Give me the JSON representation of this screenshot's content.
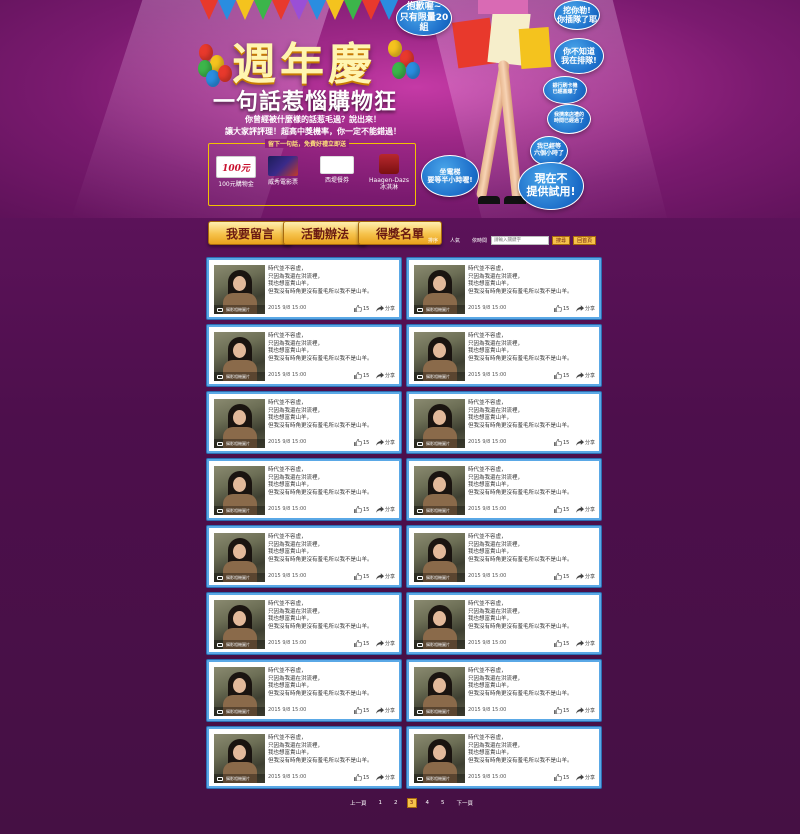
{
  "hero": {
    "title": "週年慶",
    "subtitle": "一句話惹惱購物狂",
    "desc_line1": "你曾經被什麼樣的話惹毛過？說出來！",
    "desc_line2": "讓大家評評理！超高中獎機率，你一定不能錯過！",
    "prize_box_title": "留下一句話，免費好禮立即送",
    "prizes": [
      {
        "name": "100元購物金",
        "badge": "100元"
      },
      {
        "name": "威秀電影票",
        "badge": ""
      },
      {
        "name": "西堤餐券",
        "badge": ""
      },
      {
        "name": "Haagen-Dazs\n冰淇淋",
        "badge": ""
      }
    ],
    "bubbles": [
      "抱歉喔~\n只有限量20組",
      "挖你勒!\n你插隊了耶",
      "你不知道\n我在排隊!",
      "銀行刷卡機\n已經塞爆了",
      "我擠來店禮的\n時間已經過了",
      "我已經等\n六個小時了",
      "坐電梯\n要等半小時喔!",
      "現在不\n提供試用!"
    ],
    "colors": {
      "bubble": "#1b6cc8",
      "button": "#f6c24b",
      "background": "#5a1258"
    }
  },
  "actions": {
    "leave_message": "我要留言",
    "rules": "活動辦法",
    "winners": "得獎名單"
  },
  "sort": {
    "latest": "排序",
    "popular": "人氣",
    "time": "依時間",
    "search_placeholder": "請輸入關鍵字",
    "search_button": "搜尋",
    "back_button": "回首頁"
  },
  "cards": [
    {
      "text": "時代並不容虛，\n只因為我還在洪流裡，\n我也想富貴山羊，\n但我沒有時角更沒有羞毛所以我不是山羊。",
      "date": "2015 9/8 15:00",
      "likes": "15",
      "share": "分享",
      "caption": "攝影相機圖片"
    },
    {
      "text": "時代並不容虛，\n只因為我還在洪流裡，\n我也想富貴山羊，\n但我沒有時角更沒有羞毛所以我不是山羊。",
      "date": "2015 9/8 15:00",
      "likes": "15",
      "share": "分享",
      "caption": "攝影相機圖片"
    },
    {
      "text": "時代並不容虛，\n只因為我還在洪流裡，\n我也想富貴山羊，\n但我沒有時角更沒有羞毛所以我不是山羊。",
      "date": "2015 9/8 15:00",
      "likes": "15",
      "share": "分享",
      "caption": "攝影相機圖片"
    },
    {
      "text": "時代並不容虛，\n只因為我還在洪流裡，\n我也想富貴山羊，\n但我沒有時角更沒有羞毛所以我不是山羊。",
      "date": "2015 9/8 15:00",
      "likes": "15",
      "share": "分享",
      "caption": "攝影相機圖片"
    },
    {
      "text": "時代並不容虛，\n只因為我還在洪流裡，\n我也想富貴山羊，\n但我沒有時角更沒有羞毛所以我不是山羊。",
      "date": "2015 9/8 15:00",
      "likes": "15",
      "share": "分享",
      "caption": "攝影相機圖片"
    },
    {
      "text": "時代並不容虛，\n只因為我還在洪流裡，\n我也想富貴山羊，\n但我沒有時角更沒有羞毛所以我不是山羊。",
      "date": "2015 9/8 15:00",
      "likes": "15",
      "share": "分享",
      "caption": "攝影相機圖片"
    },
    {
      "text": "時代並不容虛，\n只因為我還在洪流裡，\n我也想富貴山羊，\n但我沒有時角更沒有羞毛所以我不是山羊。",
      "date": "2015 9/8 15:00",
      "likes": "15",
      "share": "分享",
      "caption": "攝影相機圖片"
    },
    {
      "text": "時代並不容虛，\n只因為我還在洪流裡，\n我也想富貴山羊，\n但我沒有時角更沒有羞毛所以我不是山羊。",
      "date": "2015 9/8 15:00",
      "likes": "15",
      "share": "分享",
      "caption": "攝影相機圖片"
    },
    {
      "text": "時代並不容虛，\n只因為我還在洪流裡，\n我也想富貴山羊，\n但我沒有時角更沒有羞毛所以我不是山羊。",
      "date": "2015 9/8 15:00",
      "likes": "15",
      "share": "分享",
      "caption": "攝影相機圖片"
    },
    {
      "text": "時代並不容虛，\n只因為我還在洪流裡，\n我也想富貴山羊，\n但我沒有時角更沒有羞毛所以我不是山羊。",
      "date": "2015 9/8 15:00",
      "likes": "15",
      "share": "分享",
      "caption": "攝影相機圖片"
    },
    {
      "text": "時代並不容虛，\n只因為我還在洪流裡，\n我也想富貴山羊，\n但我沒有時角更沒有羞毛所以我不是山羊。",
      "date": "2015 9/8 15:00",
      "likes": "15",
      "share": "分享",
      "caption": "攝影相機圖片"
    },
    {
      "text": "時代並不容虛，\n只因為我還在洪流裡，\n我也想富貴山羊，\n但我沒有時角更沒有羞毛所以我不是山羊。",
      "date": "2015 9/8 15:00",
      "likes": "15",
      "share": "分享",
      "caption": "攝影相機圖片"
    },
    {
      "text": "時代並不容虛，\n只因為我還在洪流裡，\n我也想富貴山羊，\n但我沒有時角更沒有羞毛所以我不是山羊。",
      "date": "2015 9/8 15:00",
      "likes": "15",
      "share": "分享",
      "caption": "攝影相機圖片"
    },
    {
      "text": "時代並不容虛，\n只因為我還在洪流裡，\n我也想富貴山羊，\n但我沒有時角更沒有羞毛所以我不是山羊。",
      "date": "2015 9/8 15:00",
      "likes": "15",
      "share": "分享",
      "caption": "攝影相機圖片"
    },
    {
      "text": "時代並不容虛，\n只因為我還在洪流裡，\n我也想富貴山羊，\n但我沒有時角更沒有羞毛所以我不是山羊。",
      "date": "2015 9/8 15:00",
      "likes": "15",
      "share": "分享",
      "caption": "攝影相機圖片"
    },
    {
      "text": "時代並不容虛，\n只因為我還在洪流裡，\n我也想富貴山羊，\n但我沒有時角更沒有羞毛所以我不是山羊。",
      "date": "2015 9/8 15:00",
      "likes": "15",
      "share": "分享",
      "caption": "攝影相機圖片"
    }
  ],
  "pagination": {
    "prev": "上一頁",
    "pages": [
      "1",
      "2",
      "3",
      "4",
      "5"
    ],
    "current": "3",
    "next": "下一頁"
  }
}
